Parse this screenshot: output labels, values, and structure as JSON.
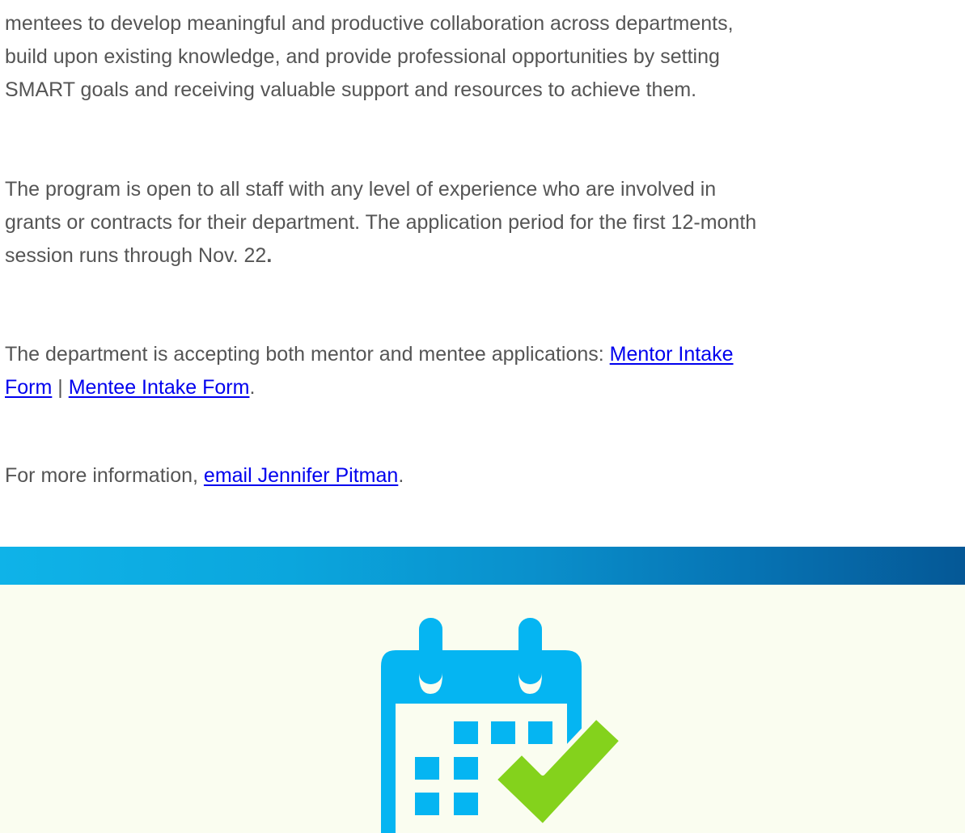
{
  "article": {
    "paragraph1": {
      "line1": "mentees to develop meaningful and productive collaboration across departments,",
      "line2": "build upon existing knowledge, and provide professional opportunities by setting",
      "line3": "SMART goals and receiving valuable support and resources to achieve them."
    },
    "paragraph2": {
      "line1": "The program is open to all staff with any level of experience who are involved in",
      "line2": "grants or contracts for their department. The application period for the first 12-month",
      "line3": "session runs through Nov. 22",
      "line3_bold": "."
    },
    "paragraph3": {
      "text_before": "The department is accepting both mentor and mentee applications: ",
      "mentor_link_part1": "Mentor Intake",
      "mentor_link_part2": "Form",
      "separator": " | ",
      "mentee_link": "Mentee Intake Form",
      "text_after": "."
    },
    "paragraph4": {
      "text_before": "For more information, ",
      "email_link": "email Jennifer Pitman",
      "text_after": "."
    }
  },
  "feature": {
    "icon": "calendar-check-icon",
    "colors": {
      "calendar": "#05b5f2",
      "check": "#84d21c",
      "panel_background": "#fafdf0",
      "band_start": "#0fb3e8",
      "band_end": "#055896",
      "link": "#0000ee",
      "body_text": "#555555"
    }
  }
}
